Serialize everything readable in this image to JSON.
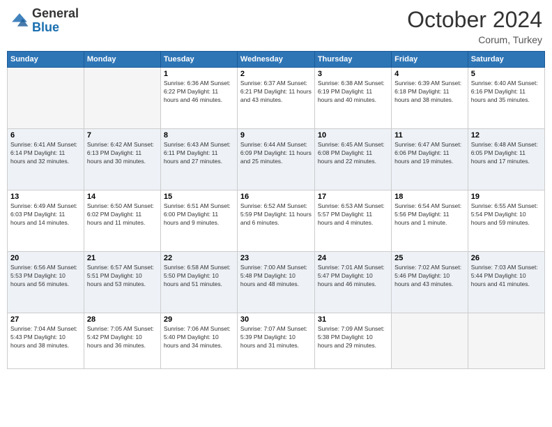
{
  "header": {
    "logo_line1": "General",
    "logo_line2": "Blue",
    "month": "October 2024",
    "location": "Corum, Turkey"
  },
  "days_of_week": [
    "Sunday",
    "Monday",
    "Tuesday",
    "Wednesday",
    "Thursday",
    "Friday",
    "Saturday"
  ],
  "weeks": [
    [
      {
        "num": "",
        "info": ""
      },
      {
        "num": "",
        "info": ""
      },
      {
        "num": "1",
        "info": "Sunrise: 6:36 AM\nSunset: 6:22 PM\nDaylight: 11 hours and 46 minutes."
      },
      {
        "num": "2",
        "info": "Sunrise: 6:37 AM\nSunset: 6:21 PM\nDaylight: 11 hours and 43 minutes."
      },
      {
        "num": "3",
        "info": "Sunrise: 6:38 AM\nSunset: 6:19 PM\nDaylight: 11 hours and 40 minutes."
      },
      {
        "num": "4",
        "info": "Sunrise: 6:39 AM\nSunset: 6:18 PM\nDaylight: 11 hours and 38 minutes."
      },
      {
        "num": "5",
        "info": "Sunrise: 6:40 AM\nSunset: 6:16 PM\nDaylight: 11 hours and 35 minutes."
      }
    ],
    [
      {
        "num": "6",
        "info": "Sunrise: 6:41 AM\nSunset: 6:14 PM\nDaylight: 11 hours and 32 minutes."
      },
      {
        "num": "7",
        "info": "Sunrise: 6:42 AM\nSunset: 6:13 PM\nDaylight: 11 hours and 30 minutes."
      },
      {
        "num": "8",
        "info": "Sunrise: 6:43 AM\nSunset: 6:11 PM\nDaylight: 11 hours and 27 minutes."
      },
      {
        "num": "9",
        "info": "Sunrise: 6:44 AM\nSunset: 6:09 PM\nDaylight: 11 hours and 25 minutes."
      },
      {
        "num": "10",
        "info": "Sunrise: 6:45 AM\nSunset: 6:08 PM\nDaylight: 11 hours and 22 minutes."
      },
      {
        "num": "11",
        "info": "Sunrise: 6:47 AM\nSunset: 6:06 PM\nDaylight: 11 hours and 19 minutes."
      },
      {
        "num": "12",
        "info": "Sunrise: 6:48 AM\nSunset: 6:05 PM\nDaylight: 11 hours and 17 minutes."
      }
    ],
    [
      {
        "num": "13",
        "info": "Sunrise: 6:49 AM\nSunset: 6:03 PM\nDaylight: 11 hours and 14 minutes."
      },
      {
        "num": "14",
        "info": "Sunrise: 6:50 AM\nSunset: 6:02 PM\nDaylight: 11 hours and 11 minutes."
      },
      {
        "num": "15",
        "info": "Sunrise: 6:51 AM\nSunset: 6:00 PM\nDaylight: 11 hours and 9 minutes."
      },
      {
        "num": "16",
        "info": "Sunrise: 6:52 AM\nSunset: 5:59 PM\nDaylight: 11 hours and 6 minutes."
      },
      {
        "num": "17",
        "info": "Sunrise: 6:53 AM\nSunset: 5:57 PM\nDaylight: 11 hours and 4 minutes."
      },
      {
        "num": "18",
        "info": "Sunrise: 6:54 AM\nSunset: 5:56 PM\nDaylight: 11 hours and 1 minute."
      },
      {
        "num": "19",
        "info": "Sunrise: 6:55 AM\nSunset: 5:54 PM\nDaylight: 10 hours and 59 minutes."
      }
    ],
    [
      {
        "num": "20",
        "info": "Sunrise: 6:56 AM\nSunset: 5:53 PM\nDaylight: 10 hours and 56 minutes."
      },
      {
        "num": "21",
        "info": "Sunrise: 6:57 AM\nSunset: 5:51 PM\nDaylight: 10 hours and 53 minutes."
      },
      {
        "num": "22",
        "info": "Sunrise: 6:58 AM\nSunset: 5:50 PM\nDaylight: 10 hours and 51 minutes."
      },
      {
        "num": "23",
        "info": "Sunrise: 7:00 AM\nSunset: 5:48 PM\nDaylight: 10 hours and 48 minutes."
      },
      {
        "num": "24",
        "info": "Sunrise: 7:01 AM\nSunset: 5:47 PM\nDaylight: 10 hours and 46 minutes."
      },
      {
        "num": "25",
        "info": "Sunrise: 7:02 AM\nSunset: 5:46 PM\nDaylight: 10 hours and 43 minutes."
      },
      {
        "num": "26",
        "info": "Sunrise: 7:03 AM\nSunset: 5:44 PM\nDaylight: 10 hours and 41 minutes."
      }
    ],
    [
      {
        "num": "27",
        "info": "Sunrise: 7:04 AM\nSunset: 5:43 PM\nDaylight: 10 hours and 38 minutes."
      },
      {
        "num": "28",
        "info": "Sunrise: 7:05 AM\nSunset: 5:42 PM\nDaylight: 10 hours and 36 minutes."
      },
      {
        "num": "29",
        "info": "Sunrise: 7:06 AM\nSunset: 5:40 PM\nDaylight: 10 hours and 34 minutes."
      },
      {
        "num": "30",
        "info": "Sunrise: 7:07 AM\nSunset: 5:39 PM\nDaylight: 10 hours and 31 minutes."
      },
      {
        "num": "31",
        "info": "Sunrise: 7:09 AM\nSunset: 5:38 PM\nDaylight: 10 hours and 29 minutes."
      },
      {
        "num": "",
        "info": ""
      },
      {
        "num": "",
        "info": ""
      }
    ]
  ]
}
